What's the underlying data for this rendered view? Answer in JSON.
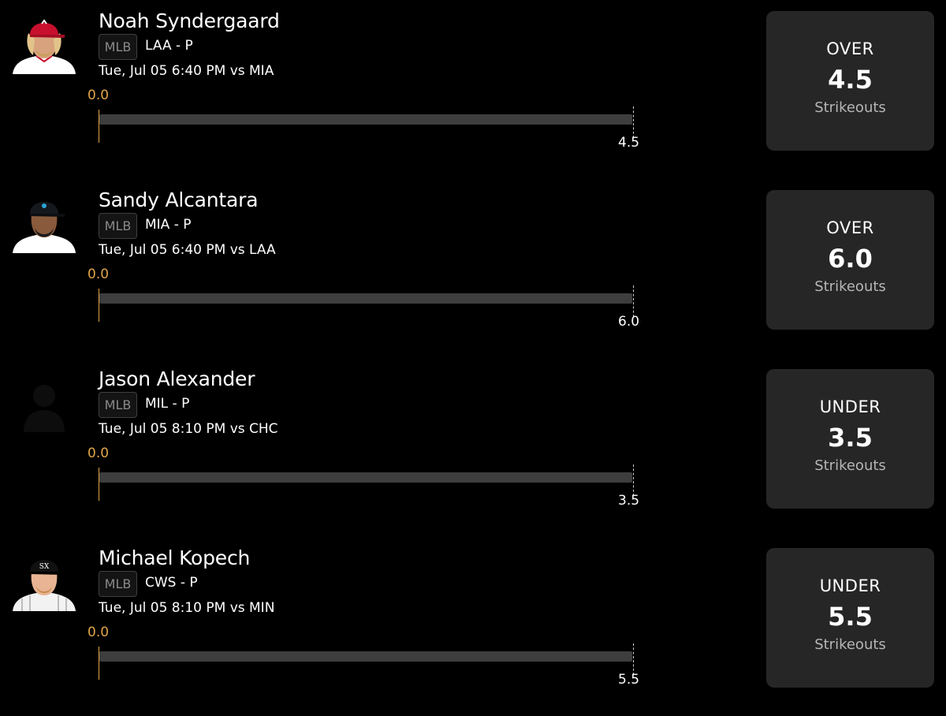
{
  "players": [
    {
      "name": "Noah Syndergaard",
      "league": "MLB",
      "team_pos": "LAA - P",
      "game": "Tue, Jul 05 6:40 PM  vs MIA",
      "progress_start": "0.0",
      "line": "4.5",
      "pick": "OVER",
      "stat": "Strikeouts",
      "avatar": "player-headshot-angels-cap"
    },
    {
      "name": "Sandy Alcantara",
      "league": "MLB",
      "team_pos": "MIA - P",
      "game": "Tue, Jul 05 6:40 PM  vs LAA",
      "progress_start": "0.0",
      "line": "6.0",
      "pick": "OVER",
      "stat": "Strikeouts",
      "avatar": "player-headshot-marlins-cap"
    },
    {
      "name": "Jason Alexander",
      "league": "MLB",
      "team_pos": "MIL - P",
      "game": "Tue, Jul 05 8:10 PM  vs CHC",
      "progress_start": "0.0",
      "line": "3.5",
      "pick": "UNDER",
      "stat": "Strikeouts",
      "avatar": "player-silhouette"
    },
    {
      "name": "Michael Kopech",
      "league": "MLB",
      "team_pos": "CWS - P",
      "game": "Tue, Jul 05 8:10 PM  vs MIN",
      "progress_start": "0.0",
      "line": "5.5",
      "pick": "UNDER",
      "stat": "Strikeouts",
      "avatar": "player-headshot-whitesox-cap"
    }
  ],
  "colors": {
    "background": "#000000",
    "card": "#262626",
    "track": "#3e3e3e",
    "accent": "#e0a548",
    "muted": "#b6b6b6"
  }
}
